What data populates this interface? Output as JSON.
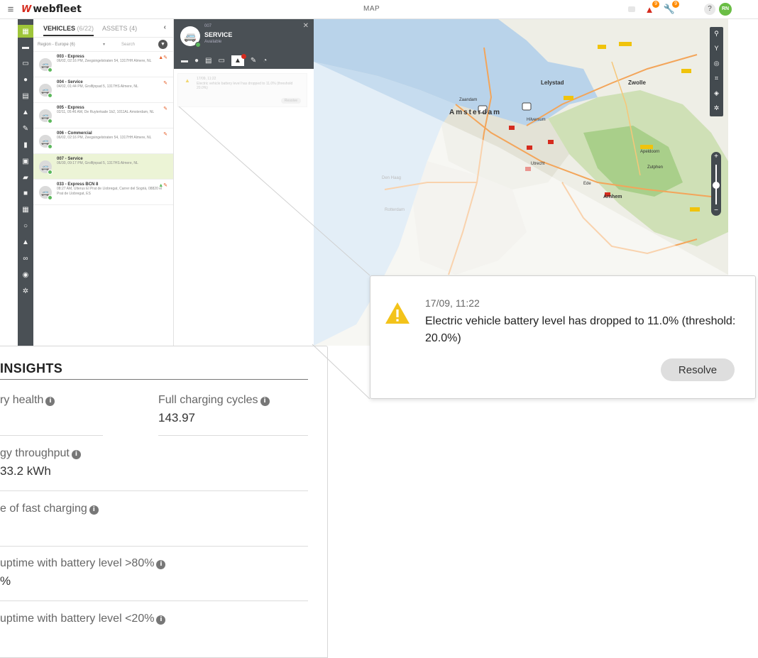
{
  "topbar": {
    "menu_icon": "hamburger-icon",
    "logo": "webfleet",
    "title": "MAP",
    "alerts_badge": "9",
    "service_badge": "9",
    "help": "?",
    "user_initials": "RN"
  },
  "rail_items": [
    "map-icon",
    "car-icon",
    "van-icon",
    "driver-icon",
    "report-icon",
    "alert-icon",
    "wrench-icon",
    "chart-icon",
    "print-icon",
    "truck-icon",
    "square-icon",
    "calendar-icon",
    "pin-icon",
    "person-icon",
    "route-icon",
    "globe-icon",
    "gear-icon"
  ],
  "vehicles": {
    "tab_vehicles": "VEHICLES",
    "tab_vehicles_count": "(6/22)",
    "tab_assets": "ASSETS",
    "tab_assets_count": "(4)",
    "region": "Region - Europe (6)",
    "search_placeholder": "Search",
    "rows": [
      {
        "name": "003 - Express",
        "address": "06/02, 02:16 PM, Zeegsingelstraten 54, 1317HH Almere, NL"
      },
      {
        "name": "004 - Service",
        "address": "04/02, 01:44 PM, Grolfijnpad 5, 1317HS Almere, NL"
      },
      {
        "name": "005 - Express",
        "address": "02/11, 05:46 AM, De Ruyterkade 1b2, 1011AL Amsterdam, NL"
      },
      {
        "name": "006 - Commercial",
        "address": "06/02, 02:16 PM, Zeegsingelstraten 54, 1317HH Almere, NL"
      },
      {
        "name": "007 - Service",
        "address": "06/30, 09:17 PM, Grolfijnpad 5, 1317HS Almere, NL"
      },
      {
        "name": "033 - Express BCN 8",
        "address": "08:27 AM, Ulterus El Prat de Llobregat, Carrer del Sogrià, 08820 el Prat de Llobregat, ES"
      }
    ]
  },
  "service": {
    "id": "007",
    "name": "SERVICE",
    "status": "Available",
    "card_time": "17/09, 11:22",
    "card_text": "Electric vehicle battery level has dropped to 11.0% (threshold 20.0%)",
    "card_button": "Resolve"
  },
  "map": {
    "cities": [
      "Amsterdam",
      "Lelystad",
      "Zwolle",
      "Zaandam",
      "Hilversum",
      "Arnhem",
      "Utrecht",
      "Apeldoorn",
      "Den Haag",
      "Rotterdam",
      "Ede",
      "Zutphen"
    ]
  },
  "alert": {
    "time": "17/09, 11:22",
    "message": "Electric vehicle battery level has dropped to 11.0% (threshold: 20.0%)",
    "resolve": "Resolve"
  },
  "insights": {
    "title": "INSIGHTS",
    "battery_health_label": "ry health",
    "battery_health_value": "",
    "full_cycles_label": "Full charging cycles",
    "full_cycles_value": "143.97",
    "energy_label": "gy throughput",
    "energy_value": "33.2 kWh",
    "fast_label": "e of fast charging",
    "fast_value": "",
    "high_label": "uptime with battery level >80%",
    "high_value": "%",
    "low_label": "uptime with battery level <20%",
    "low_value": ""
  }
}
